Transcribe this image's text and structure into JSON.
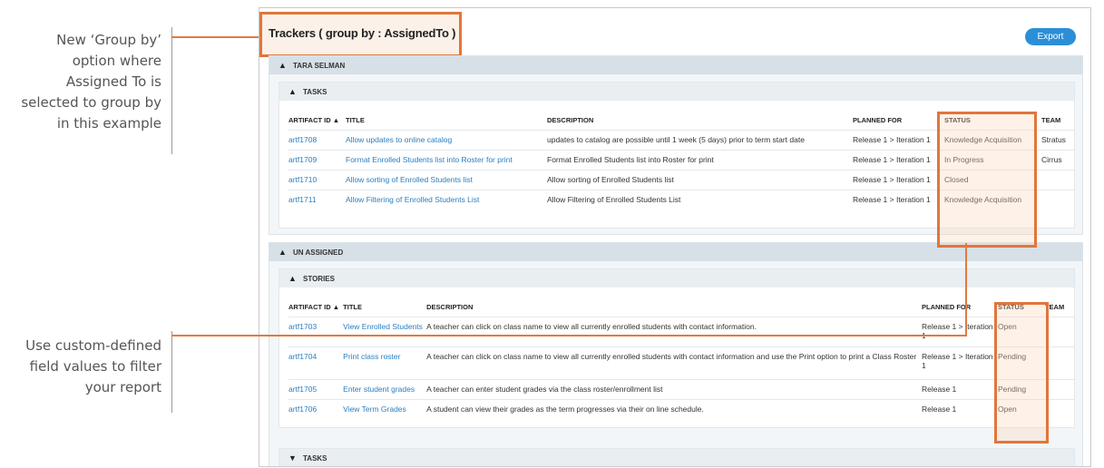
{
  "callouts": {
    "top": [
      "New ‘Group by’",
      "option where",
      "Assigned To is",
      "selected to group by",
      "in this example"
    ],
    "bottom": [
      "Use custom-defined",
      "field values to filter",
      "your report"
    ]
  },
  "header": {
    "title": "Trackers ( group by : AssignedTo )",
    "export_label": "Export"
  },
  "groups": [
    {
      "label": "TARA SELMAN",
      "sections": [
        {
          "label": "TASKS",
          "columns": [
            "ARTIFACT ID ▲",
            "TITLE",
            "DESCRIPTION",
            "PLANNED FOR",
            "STATUS",
            "TEAM"
          ],
          "rows": [
            [
              "artf1708",
              "Allow updates to online catalog",
              "updates to catalog are possible until 1 week (5 days) prior to term start date",
              "Release 1 > Iteration 1",
              "Knowledge Acquisition",
              "Stratus"
            ],
            [
              "artf1709",
              "Format Enrolled Students list into Roster for print",
              "Format Enrolled Students list into Roster for print",
              "Release 1 > Iteration 1",
              "In Progress",
              "Cirrus"
            ],
            [
              "artf1710",
              "Allow sorting of Enrolled Students list",
              "Allow sorting of Enrolled Students list",
              "Release 1 > Iteration 1",
              "Closed",
              ""
            ],
            [
              "artf1711",
              "Allow Filtering of Enrolled Students List",
              "Allow Filtering of Enrolled Students List",
              "Release 1 > Iteration 1",
              "Knowledge Acquisition",
              ""
            ]
          ]
        }
      ]
    },
    {
      "label": "UN ASSIGNED",
      "sections": [
        {
          "label": "STORIES",
          "columns": [
            "ARTIFACT ID ▲",
            "TITLE",
            "DESCRIPTION",
            "PLANNED FOR",
            "STATUS",
            "TEAM"
          ],
          "rows": [
            [
              "artf1703",
              "View Enrolled Students",
              "A teacher can click on class name to view all currently enrolled students with contact information.",
              "Release 1 > Iteration 1",
              "Open",
              ""
            ],
            [
              "artf1704",
              "Print class roster",
              "A teacher can click on class name to view all currently enrolled students with contact information and use the Print option to print a Class Roster",
              "Release 1 > Iteration 1",
              "Pending",
              ""
            ],
            [
              "artf1705",
              "Enter student grades",
              "A teacher can enter student grades via the class roster/enrollment list",
              "Release 1",
              "Pending",
              ""
            ],
            [
              "artf1706",
              "View Term Grades",
              "A student can view their grades as the term progresses via their on line schedule.",
              "Release 1",
              "Open",
              ""
            ]
          ]
        },
        {
          "label": "TASKS"
        }
      ]
    }
  ],
  "colors": {
    "accent": "#e0763c",
    "link": "#2a7fc1",
    "button": "#2b8fd6"
  }
}
